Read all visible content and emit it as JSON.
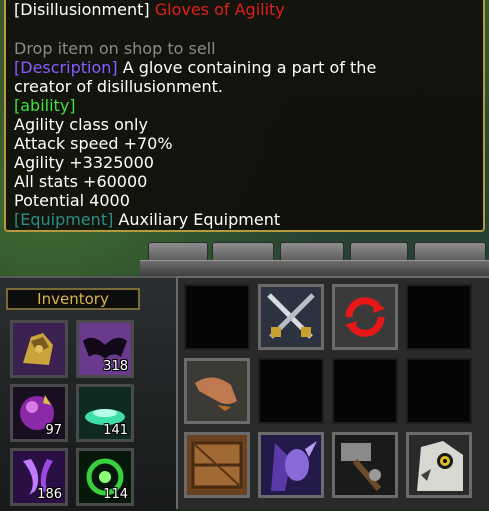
{
  "tooltip": {
    "title_bracket": "[Disillusionment]",
    "title_name": "Gloves of Agility",
    "hint": "Drop item on shop to sell",
    "description_tag": "[Description]",
    "description_line1": " A glove containing a part of the",
    "description_line2": "creator of disillusionment.",
    "ability_tag": "[ability]",
    "stats": [
      "Agility class only",
      "Attack speed +70%",
      "Agility +3325000",
      "All stats +60000",
      "Potential 4000"
    ],
    "equipment_tag": "[Equipment]",
    "equipment_value": " Auxiliary Equipment"
  },
  "inventory": {
    "title": "Inventory",
    "slots": [
      {
        "icon": "gauntlet-icon",
        "count": ""
      },
      {
        "icon": "bat-wings-icon",
        "count": "318"
      },
      {
        "icon": "purple-orb-icon",
        "count": "97"
      },
      {
        "icon": "green-potion-icon",
        "count": "141"
      },
      {
        "icon": "purple-fang-icon",
        "count": "186"
      },
      {
        "icon": "green-swirl-icon",
        "count": "114"
      }
    ]
  },
  "command_grid": {
    "cells": [
      {
        "icon": ""
      },
      {
        "icon": "crossed-swords-icon"
      },
      {
        "icon": "red-cycle-icon"
      },
      {
        "icon": ""
      },
      {
        "icon": "grab-hand-icon"
      },
      {
        "icon": ""
      },
      {
        "icon": ""
      },
      {
        "icon": ""
      },
      {
        "icon": "wooden-crate-icon"
      },
      {
        "icon": "night-elf-icon"
      },
      {
        "icon": "hammer-icon"
      },
      {
        "icon": "owl-icon"
      }
    ]
  },
  "colors": {
    "title_red": "#e0201c",
    "tag_purple": "#8a5cff",
    "tag_green": "#3fe23f",
    "tag_teal": "#2f8a8c",
    "gold_border": "#b79a3e"
  }
}
